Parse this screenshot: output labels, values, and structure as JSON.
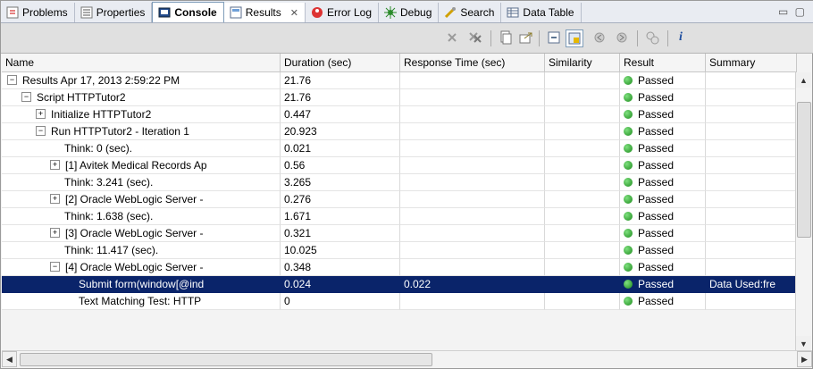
{
  "tabs": [
    {
      "label": "Problems",
      "icon": "problems-icon"
    },
    {
      "label": "Properties",
      "icon": "properties-icon"
    },
    {
      "label": "Console",
      "icon": "console-icon"
    },
    {
      "label": "Results",
      "icon": "results-icon",
      "close": "✕"
    },
    {
      "label": "Error Log",
      "icon": "error-log-icon"
    },
    {
      "label": "Debug",
      "icon": "debug-icon"
    },
    {
      "label": "Search",
      "icon": "search-icon"
    },
    {
      "label": "Data Table",
      "icon": "data-table-icon"
    }
  ],
  "columns": [
    "Name",
    "Duration (sec)",
    "Response Time (sec)",
    "Similarity",
    "Result",
    "Summary"
  ],
  "rows": [
    {
      "indent": 0,
      "expander": "−",
      "name": "Results Apr 17, 2013 2:59:22 PM",
      "duration": "21.76",
      "response": "",
      "similarity": "",
      "result": "Passed",
      "summary": ""
    },
    {
      "indent": 1,
      "expander": "−",
      "name": "Script HTTPTutor2",
      "duration": "21.76",
      "response": "",
      "similarity": "",
      "result": "Passed",
      "summary": ""
    },
    {
      "indent": 2,
      "expander": "+",
      "name": "Initialize HTTPTutor2",
      "duration": "0.447",
      "response": "",
      "similarity": "",
      "result": "Passed",
      "summary": ""
    },
    {
      "indent": 2,
      "expander": "−",
      "name": "Run HTTPTutor2 - Iteration 1",
      "duration": "20.923",
      "response": "",
      "similarity": "",
      "result": "Passed",
      "summary": ""
    },
    {
      "indent": 4,
      "expander": "",
      "name": "Think: 0 (sec).",
      "duration": "0.021",
      "response": "",
      "similarity": "",
      "result": "Passed",
      "summary": ""
    },
    {
      "indent": 3,
      "expander": "+",
      "name": "[1] Avitek Medical Records Ap",
      "duration": "0.56",
      "response": "",
      "similarity": "",
      "result": "Passed",
      "summary": ""
    },
    {
      "indent": 4,
      "expander": "",
      "name": "Think: 3.241 (sec).",
      "duration": "3.265",
      "response": "",
      "similarity": "",
      "result": "Passed",
      "summary": ""
    },
    {
      "indent": 3,
      "expander": "+",
      "name": "[2] Oracle WebLogic Server -",
      "duration": "0.276",
      "response": "",
      "similarity": "",
      "result": "Passed",
      "summary": ""
    },
    {
      "indent": 4,
      "expander": "",
      "name": "Think: 1.638 (sec).",
      "duration": "1.671",
      "response": "",
      "similarity": "",
      "result": "Passed",
      "summary": ""
    },
    {
      "indent": 3,
      "expander": "+",
      "name": "[3] Oracle WebLogic Server -",
      "duration": "0.321",
      "response": "",
      "similarity": "",
      "result": "Passed",
      "summary": ""
    },
    {
      "indent": 4,
      "expander": "",
      "name": "Think: 11.417 (sec).",
      "duration": "10.025",
      "response": "",
      "similarity": "",
      "result": "Passed",
      "summary": ""
    },
    {
      "indent": 3,
      "expander": "−",
      "name": "[4] Oracle WebLogic Server -",
      "duration": "0.348",
      "response": "",
      "similarity": "",
      "result": "Passed",
      "summary": ""
    },
    {
      "indent": 5,
      "expander": "",
      "name": "Submit form(window[@ind",
      "duration": "0.024",
      "response": "0.022",
      "similarity": "",
      "result": "Passed",
      "summary": "Data Used:fre",
      "selected": true
    },
    {
      "indent": 5,
      "expander": "",
      "name": "Text Matching Test: HTTP",
      "duration": "0",
      "response": "",
      "similarity": "",
      "result": "Passed",
      "summary": ""
    }
  ],
  "colors": {
    "selection": "#0a246a",
    "pass": "#1b8a1b"
  }
}
